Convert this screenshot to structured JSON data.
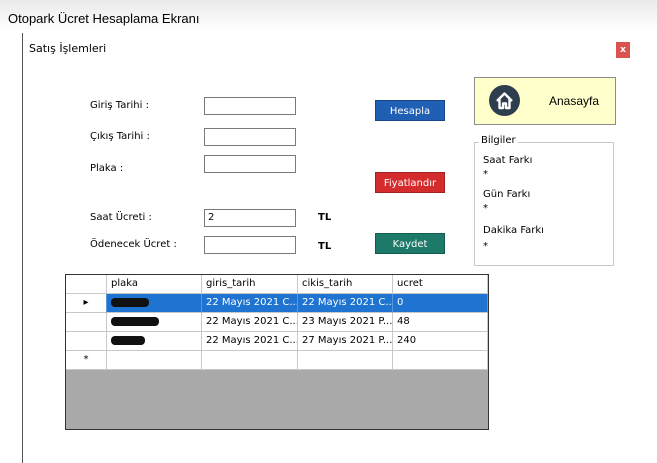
{
  "window": {
    "title": "Otopark Ücret Hesaplama Ekranı"
  },
  "form": {
    "title": "Satış İşlemleri",
    "close_label": "x"
  },
  "labels": {
    "giris": "Giriş  Tarihi :",
    "cikis": "Çıkış Tarihi :",
    "plaka": "Plaka :",
    "saat_ucreti": "Saat Ücreti :",
    "odenecek": "Ödenecek Ücret :",
    "tl1": "TL",
    "tl2": "TL"
  },
  "inputs": {
    "giris_value": "",
    "cikis_value": "",
    "plaka_value": "",
    "saat_ucreti_value": "2",
    "odenecek_value": ""
  },
  "buttons": {
    "hesapla": "Hesapla",
    "fiyatlandir": "Fiyatlandır",
    "kaydet": "Kaydet",
    "anasayfa": "Anasayfa"
  },
  "colors": {
    "hesapla": "#1f5fb4",
    "fiyatlandir": "#d42c2c",
    "kaydet": "#1d7a68"
  },
  "bilgiler": {
    "title": "Bilgiler",
    "saat_farki": "Saat Farkı",
    "saat_value": "*",
    "gun_farki": "Gün Farkı",
    "gun_value": "*",
    "dakika_farki": "Dakika Farkı",
    "dakika_value": "*"
  },
  "grid": {
    "columns": [
      "plaka",
      "giris_tarih",
      "cikis_tarih",
      "ucret"
    ],
    "rows": [
      {
        "marker": "▸",
        "plaka": "",
        "giris": "22 Mayıs 2021 C...",
        "cikis": "22 Mayıs 2021 C...",
        "ucret": "0"
      },
      {
        "marker": "",
        "plaka": "",
        "giris": "22 Mayıs 2021 C...",
        "cikis": "23 Mayıs 2021 P...",
        "ucret": "48"
      },
      {
        "marker": "",
        "plaka": "",
        "giris": "22 Mayıs 2021 C...",
        "cikis": "27 Mayıs 2021 P...",
        "ucret": "240"
      }
    ],
    "new_row_marker": "*"
  }
}
